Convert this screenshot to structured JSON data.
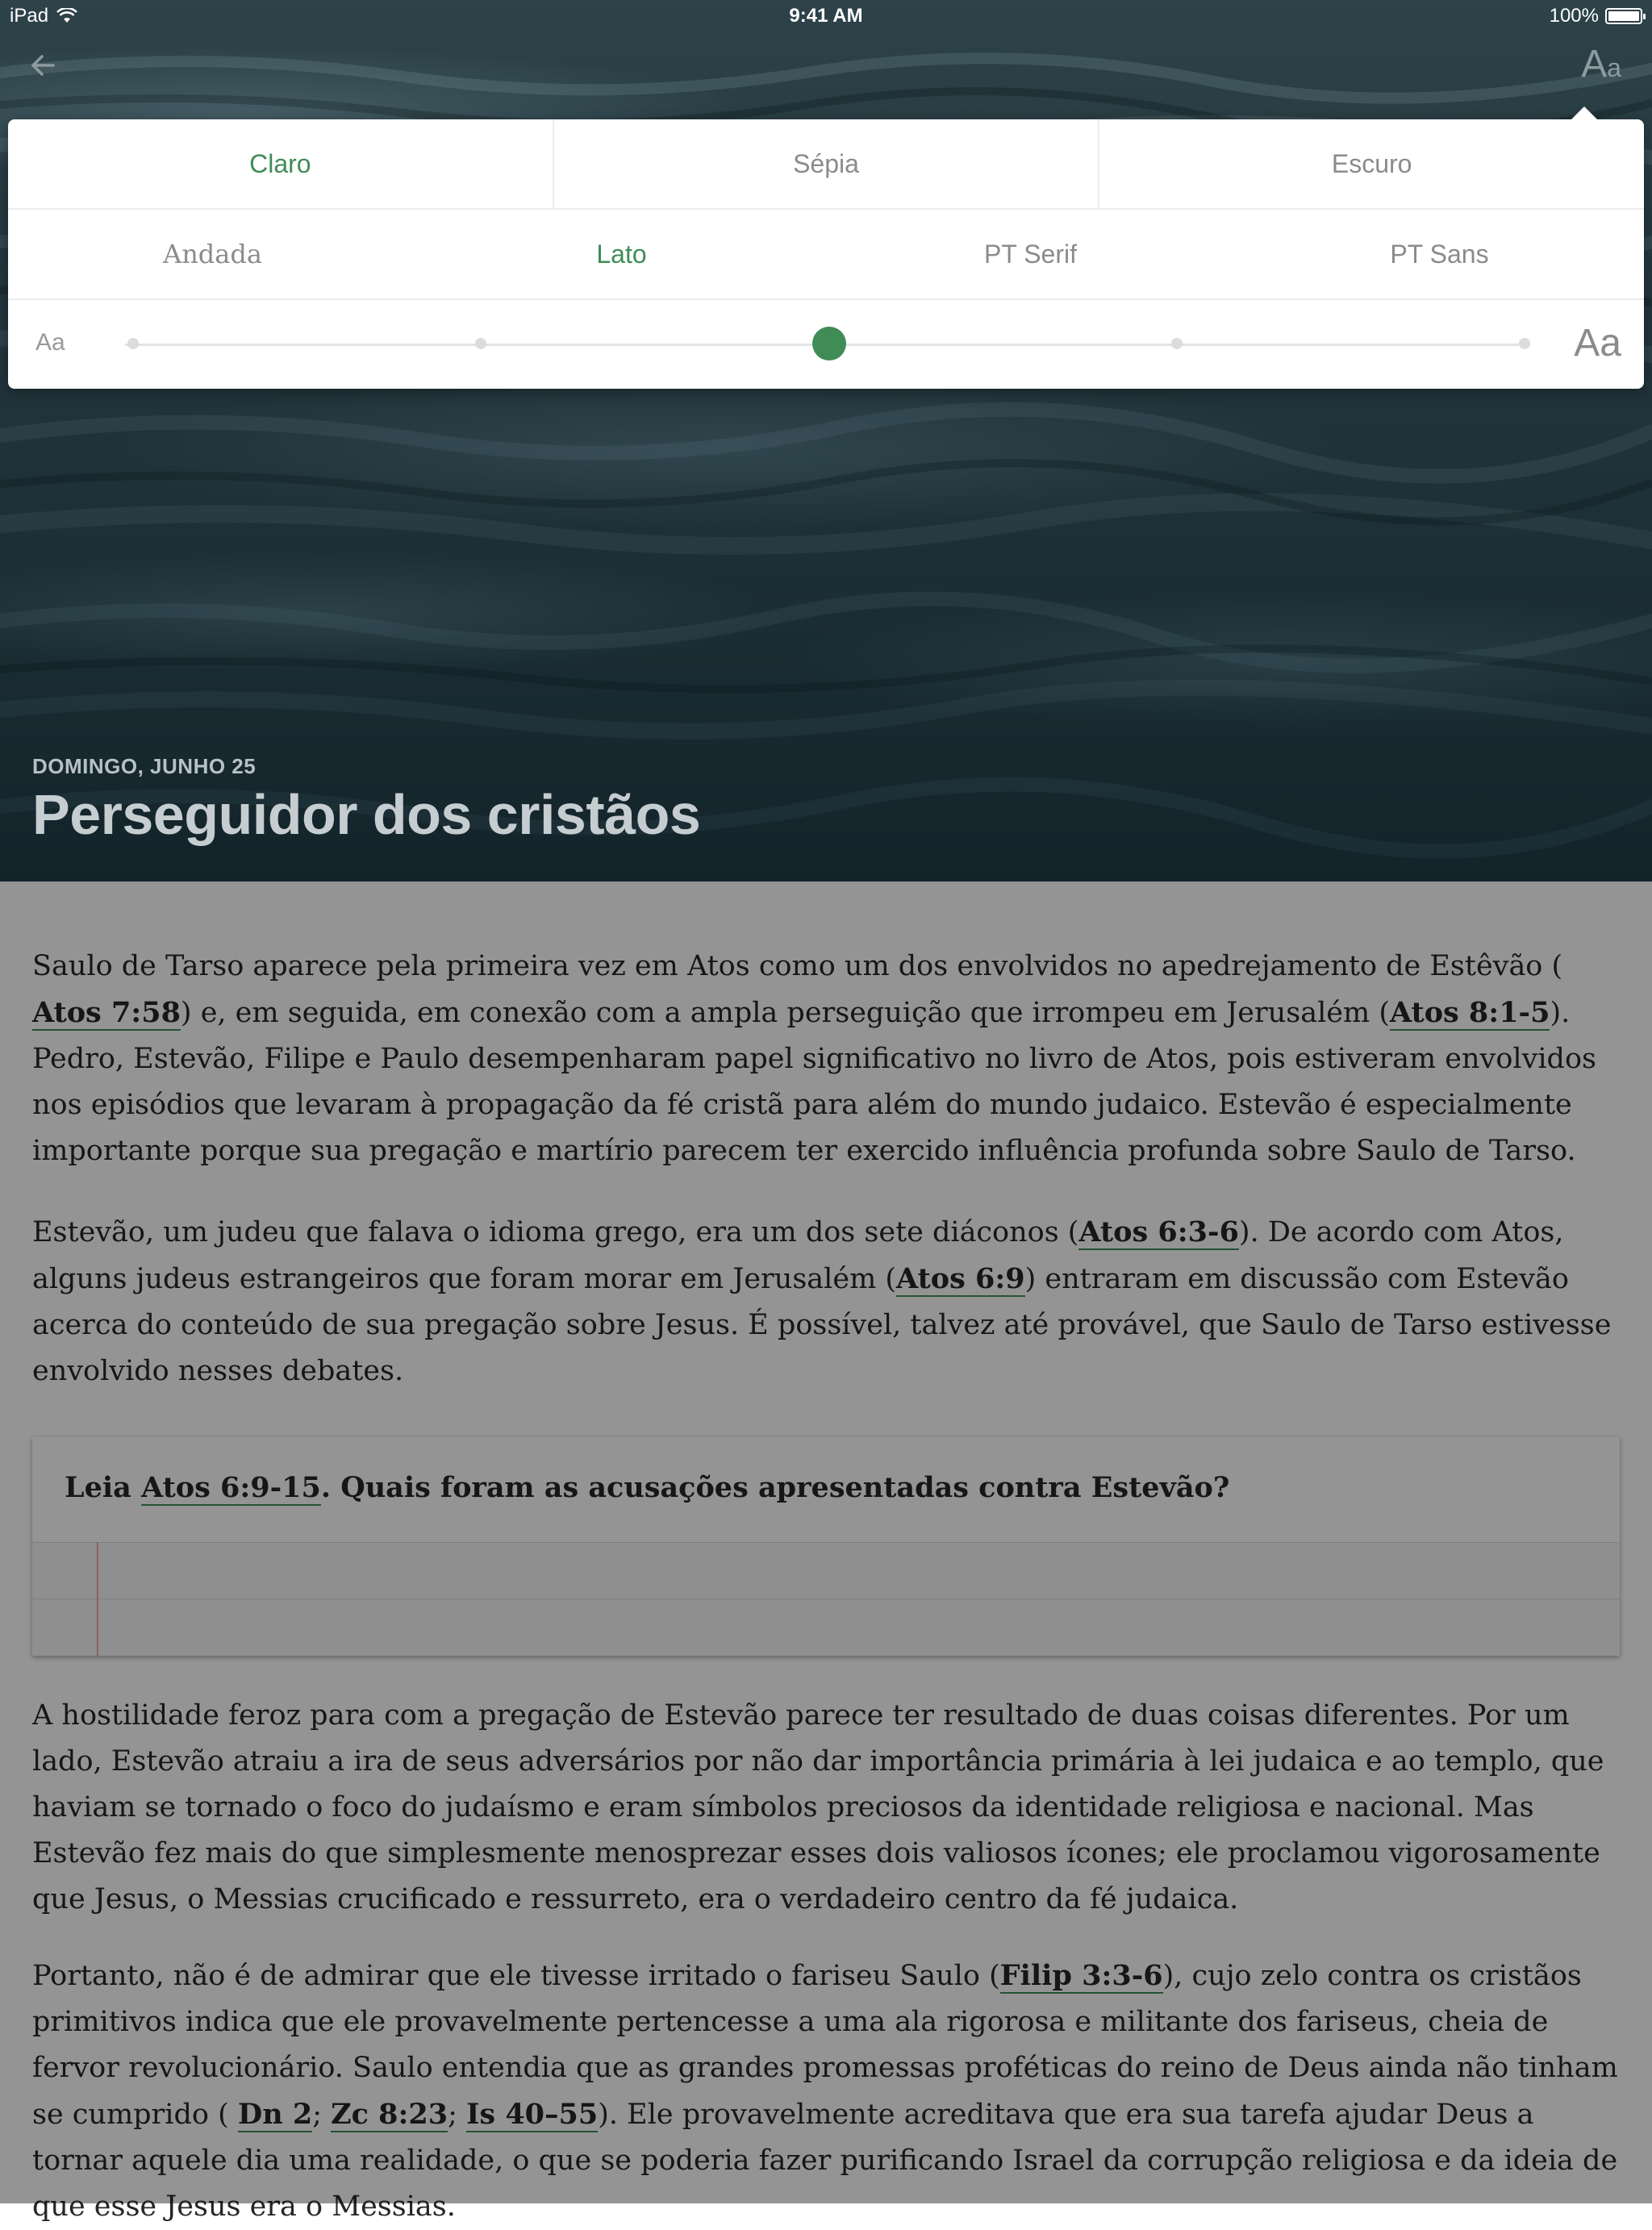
{
  "status_bar": {
    "device": "iPad",
    "time": "9:41 AM",
    "battery": "100%"
  },
  "header": {
    "back_icon": "arrow-left-icon",
    "text_settings_icon": "font-size-icon"
  },
  "hero": {
    "date": "DOMINGO, JUNHO 25",
    "title": "Perseguidor dos cristãos"
  },
  "settings": {
    "themes": [
      "Claro",
      "Sépia",
      "Escuro"
    ],
    "active_theme": "Claro",
    "fonts": [
      "Andada",
      "Lato",
      "PT Serif",
      "PT Sans"
    ],
    "active_font": "Lato",
    "size_small_label": "Aa",
    "size_large_label": "Aa",
    "size_steps": 5,
    "size_level": 3,
    "accent_color": "#3f8c57"
  },
  "article": {
    "p1": {
      "t1": "Saulo de Tarso aparece pela primeira vez em Atos como um dos envolvidos no apedrejamento de Estêvão ( ",
      "ref1": "Atos 7:58",
      "t2": ") e, em seguida, em conexão com a ampla perseguição que irrompeu em Jerusalém (",
      "ref2": "Atos 8:1-5",
      "t3": "). Pedro, Estevão, Filipe e Paulo desempenharam papel significativo no livro de Atos, pois estiveram envolvidos nos episódios que levaram à propagação da fé cristã para além do mundo judaico. Estevão é especialmente importante porque sua pregação e martírio parecem ter exercido influência profunda sobre Saulo de Tarso."
    },
    "p2": {
      "t1": "Estevão, um judeu que falava o idioma grego, era um dos sete diáconos (",
      "ref1": "Atos 6:3-6",
      "t2": "). De acordo com Atos, alguns judeus estrangeiros que foram morar em Jerusalém (",
      "ref2": "Atos 6:9",
      "t3": ") entraram em discussão com Estevão acerca do conteúdo de sua pregação sobre Jesus. É possível, talvez até provável, que Saulo de Tarso estivesse envolvido nesses debates."
    },
    "question": {
      "t1": "Leia ",
      "ref": "Atos 6:9-15",
      "t2": ". Quais foram as acusações apresentadas contra Estevão?"
    },
    "p3": {
      "text": "A hostilidade feroz para com a pregação de Estevão parece ter resultado de duas coisas diferentes. Por um lado, Estevão atraiu a ira de seus adversários por não dar importância primária à lei judaica e ao templo, que haviam se tornado o foco do judaísmo e eram símbolos preciosos da identidade religiosa e nacional. Mas Estevão fez mais do que simplesmente menosprezar esses dois valiosos ícones; ele proclamou vigorosamente que Jesus, o Messias crucificado e ressurreto, era o verdadeiro centro da fé judaica."
    },
    "p4": {
      "t1": "Portanto, não é de admirar que ele tivesse irritado o fariseu Saulo (",
      "ref1": "Filip 3:3-6",
      "t2": "), cujo zelo contra os cristãos primitivos indica que ele provavelmente pertencesse a uma ala rigorosa e militante dos fariseus, cheia de fervor revolucionário. Saulo entendia que as grandes promessas proféticas do reino de Deus ainda não tinham se cumprido ( ",
      "ref2": "Dn 2",
      "sep1": "; ",
      "ref3": "Zc 8:23",
      "sep2": "; ",
      "ref4": "Is 40–55",
      "t3": "). Ele provavelmente acreditava que era sua tarefa ajudar Deus a tornar aquele dia uma realidade, o que se poderia fazer purificando Israel da corrupção religiosa e da ideia de que esse Jesus era o Messias."
    }
  }
}
